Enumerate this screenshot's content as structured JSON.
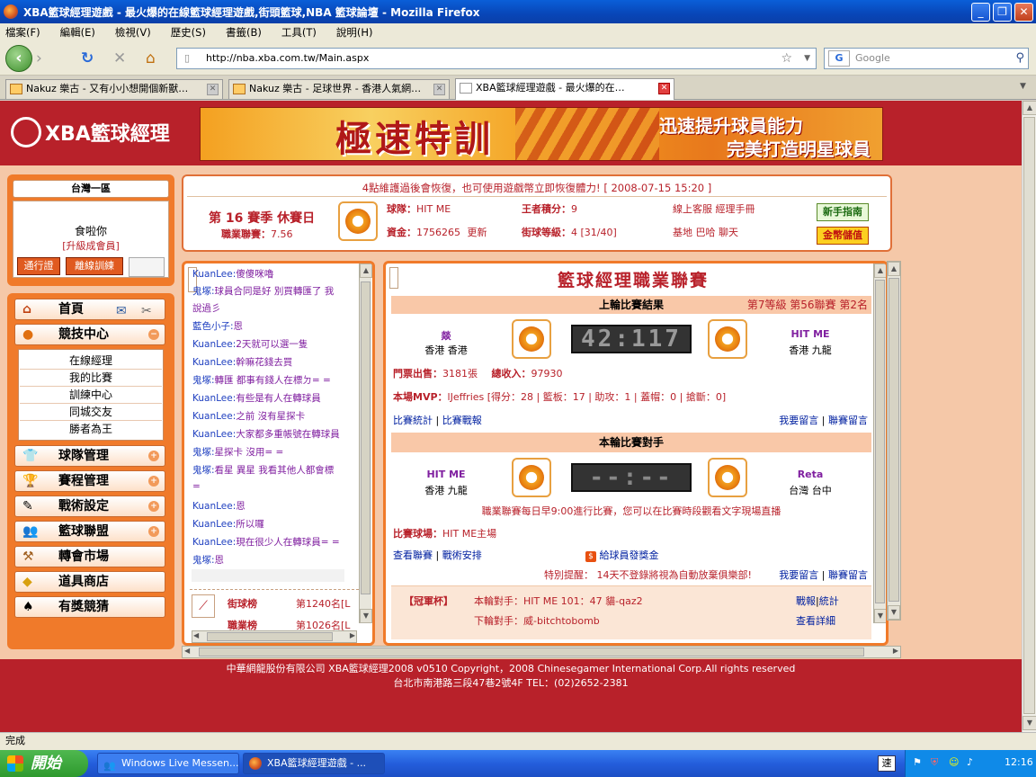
{
  "window": {
    "title": "XBA籃球經理遊戲 - 最火爆的在線籃球經理遊戲,街頭籃球,NBA 籃球論壇 - Mozilla Firefox"
  },
  "menu": [
    "檔案(F)",
    "編輯(E)",
    "檢視(V)",
    "歷史(S)",
    "書籤(B)",
    "工具(T)",
    "說明(H)"
  ],
  "nav": {
    "url": "http://nba.xba.com.tw/Main.aspx",
    "search_placeholder": "Google"
  },
  "tabs": [
    {
      "label": "Nakuz 樂古 - 又有小小想開個新獸…"
    },
    {
      "label": "Nakuz 樂古 - 足球世界 - 香港人氣網…"
    },
    {
      "label": "XBA籃球經理遊戲 - 最火爆的在…"
    }
  ],
  "site": {
    "logo": "XBA籃球經理",
    "banner": {
      "title": "極速特訓",
      "line1": "迅速提升球員能力",
      "line2": "完美打造明星球員"
    }
  },
  "account": {
    "server": "台灣一區",
    "username": "食啦你",
    "upgrade": "[升級成會員]",
    "pass_button": "通行證",
    "offline_button": "離線訓練"
  },
  "left_menu": {
    "home": "首頁",
    "arena": "競技中心",
    "arena_items": [
      "在線經理",
      "我的比賽",
      "訓練中心",
      "同城交友",
      "勝者為王"
    ],
    "items": [
      "球隊管理",
      "賽程管理",
      "戰術設定",
      "籃球聯盟",
      "轉會市場",
      "道具商店",
      "有獎競猜"
    ]
  },
  "info": {
    "notice": "4點維護過後會恢復，也可使用遊戲幣立即恢復體力!",
    "timestamp": "[ 2008-07-15 15:20 ]",
    "season": "第 16 賽季 休賽日",
    "league_label": "職業聯賽：",
    "league_value": "7.56",
    "team_label": "球隊：",
    "team_value": "HIT ME",
    "king_label": "王者積分：",
    "king_value": "9",
    "cash_label": "資金：",
    "cash_value": "1756265",
    "cash_update": "更新",
    "street_label": "街球等級：",
    "street_value": "4 [31/40]",
    "online_service": "線上客服 經理手冊",
    "base_links": "基地 巴哈 聊天",
    "guide_button": "新手指南",
    "gold_button": "金幣儲值"
  },
  "chat": {
    "lines": [
      {
        "name": "KuanLee:",
        "text": "傻傻咪嚕"
      },
      {
        "name": "鬼塚:",
        "text": "球員合同是好  別買轉匯了  我"
      },
      {
        "name": "",
        "text": "說過彡"
      },
      {
        "name": "藍色小子:",
        "text": "恩"
      },
      {
        "name": "KuanLee:",
        "text": "2天就可以選一隻"
      },
      {
        "name": "KuanLee:",
        "text": "幹嘛花錢去買"
      },
      {
        "name": "鬼塚:",
        "text": "轉匯  都事有錢人在標ㄉ= ="
      },
      {
        "name": "KuanLee:",
        "text": "有些是有人在轉球員"
      },
      {
        "name": "KuanLee:",
        "text": "之前  沒有星探卡"
      },
      {
        "name": "KuanLee:",
        "text": "大家都多重帳號在轉球員"
      },
      {
        "name": "鬼塚:",
        "text": "星探卡  沒用= ="
      },
      {
        "name": "鬼塚:",
        "text": "看星  異星  我看其他人都會標"
      },
      {
        "name": "",
        "text": "="
      },
      {
        "name": "KuanLee:",
        "text": "恩"
      },
      {
        "name": "KuanLee:",
        "text": "所以囉"
      },
      {
        "name": "KuanLee:",
        "text": "現在很少人在轉球員= ="
      },
      {
        "name": "鬼塚:",
        "text": "恩"
      }
    ],
    "rank1_label": "街球榜",
    "rank1_value": "第1240名[L",
    "rank2_label": "職業榜",
    "rank2_value": "第1026名[L"
  },
  "main": {
    "title": "籃球經理職業聯賽",
    "last_header": "上輪比賽結果",
    "last_meta": "第7等級 第56聯賽 第2名",
    "home_team": "燚",
    "home_city": "香港 香港",
    "score": "42:117",
    "away_team": "HIT ME",
    "away_city": "香港 九龍",
    "tickets_label": "門票出售：",
    "tickets_value": "3181張",
    "income_label": "總收入：",
    "income_value": "97930",
    "mvp_label": "本場MVP：",
    "mvp_value": "lJeffries [得分：28 | 籃板：17 | 助攻：1 | 蓋帽：0 | 搶斷：0]",
    "link_stats": "比賽統計",
    "link_report": "比賽戰報",
    "link_comment": "我要留言",
    "link_forum": "聯賽留言",
    "next_header": "本輪比賽對手",
    "next_home": "HIT ME",
    "next_home_city": "香港 九龍",
    "next_score": "--:--",
    "next_away": "Reta",
    "next_away_city": "台灣 台中",
    "schedule_note": "職業聯賽每日早9:00進行比賽，您可以在比賽時段觀看文字現場直播",
    "venue_label": "比賽球場：",
    "venue_value": "HIT ME主場",
    "link_view_league": "查看聯賽",
    "link_tactics": "戰術安排",
    "bonus_link": "給球員發獎金",
    "reminder": "特別提醒：  14天不登錄將視為自動放棄俱樂部!",
    "link_comment2": "我要留言",
    "link_forum2": "聯賽留言",
    "cup_label": "【冠軍杯】",
    "cup_opponent": "本輪對手：HIT ME 101：47 貓-qaz2",
    "cup_next": "下輪對手：威-bitchtobomb",
    "cup_link1": "戰報",
    "cup_link2": "統計",
    "cup_link3": "查看詳細"
  },
  "footer": {
    "line1": "中華網龍股份有限公司 XBA籃球經理2008 v0510      Copyright，2008 Chinesegamer International Corp.All rights reserved",
    "line2": "台北市南港路三段47巷2號4F TEL：(02)2652-2381"
  },
  "status": "完成",
  "taskbar": {
    "start": "開始",
    "tasks": [
      "Windows Live Messen...",
      "XBA籃球經理遊戲 - ..."
    ],
    "clock": "12:16"
  }
}
